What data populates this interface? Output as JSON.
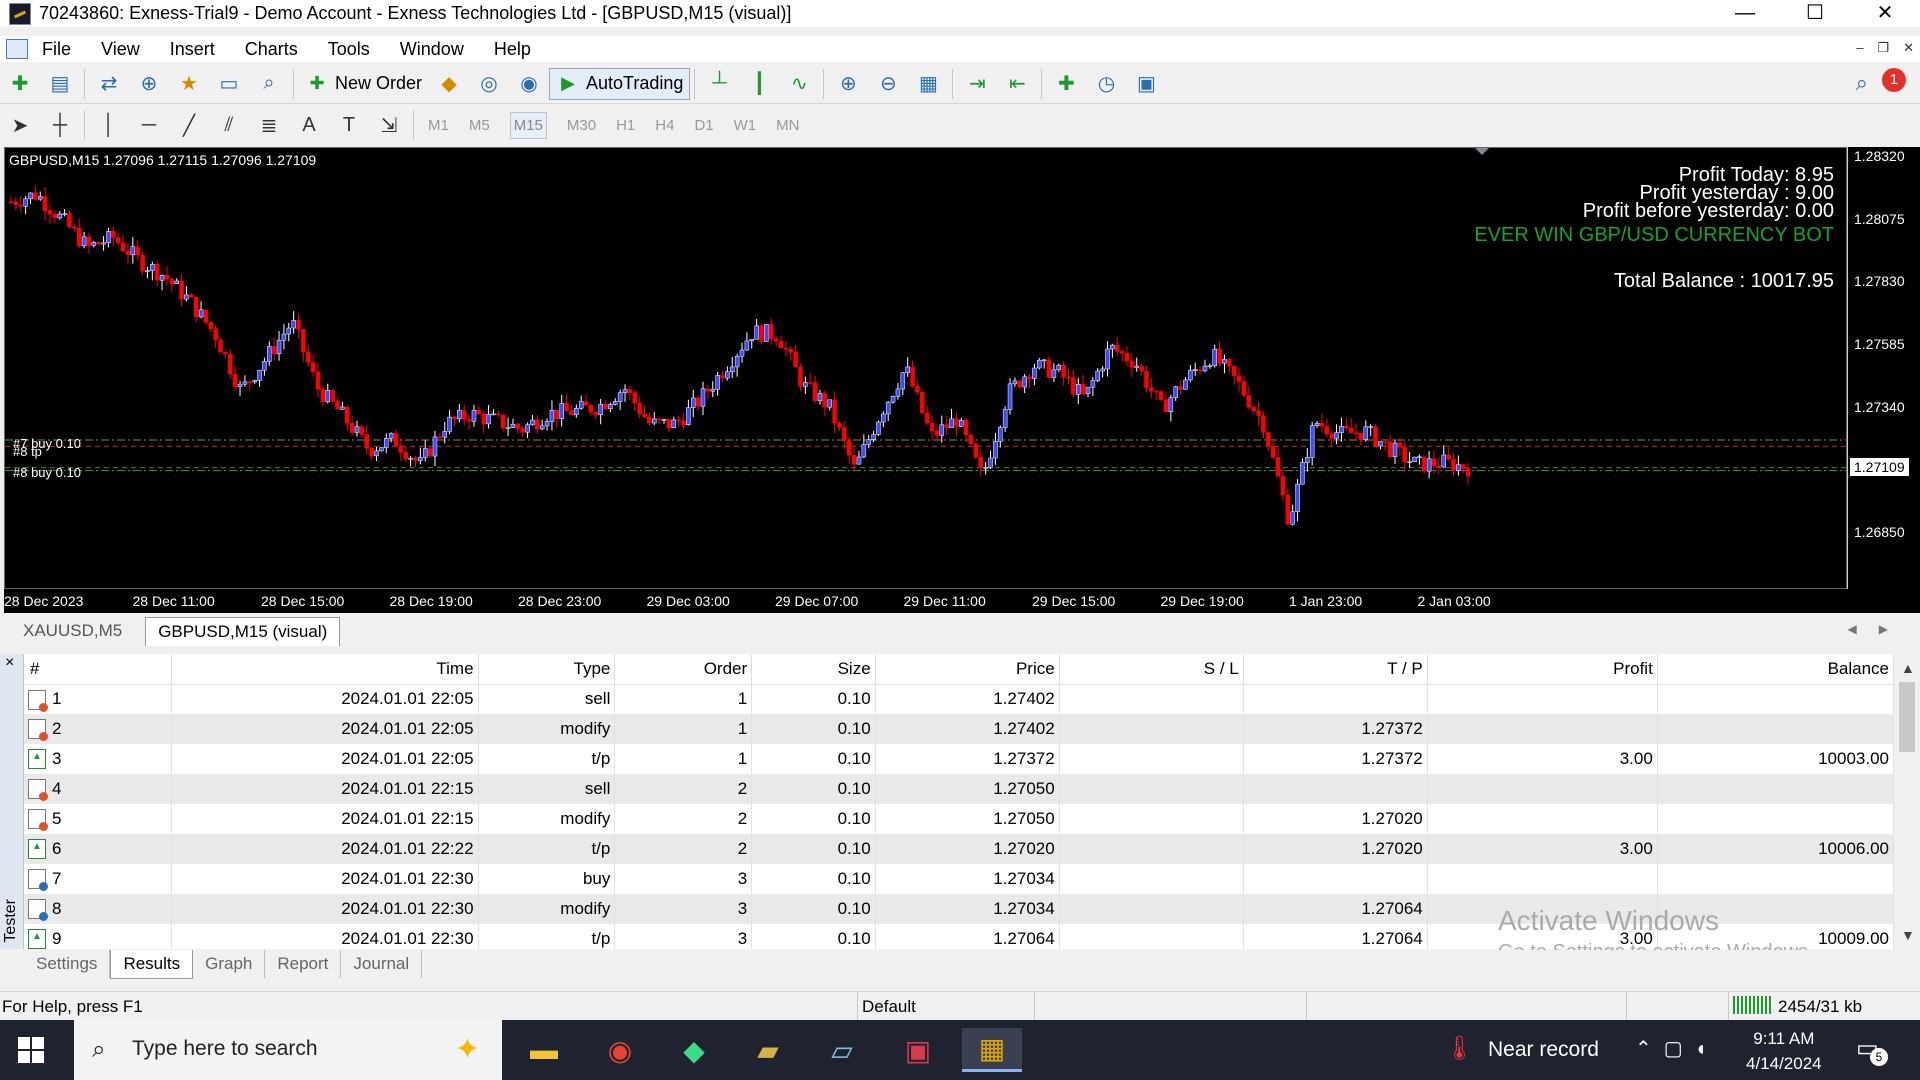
{
  "window": {
    "title": "70243860: Exness-Trial9 - Demo Account - Exness Technologies Ltd - [GBPUSD,M15 (visual)]",
    "minimize": "—",
    "maximize": "☐",
    "close": "✕"
  },
  "menu": [
    "File",
    "View",
    "Insert",
    "Charts",
    "Tools",
    "Window",
    "Help"
  ],
  "toolbar": {
    "new_order": "New Order",
    "autotrading": "AutoTrading",
    "alerts_count": "1"
  },
  "timeframes": [
    "M1",
    "M5",
    "M15",
    "M30",
    "H1",
    "H4",
    "D1",
    "W1",
    "MN"
  ],
  "timeframe_active": "M15",
  "chart": {
    "header": "GBPUSD,M15  1.27096 1.27115 1.27096 1.27109",
    "profit_today": "Profit Today: 8.95",
    "profit_yesterday": "Profit yesterday : 9.00",
    "profit_before_yesterday": "Profit before yesterday: 0.00",
    "bot_name": "EVER WIN GBP/USD CURRENCY BOT",
    "total_balance": "Total Balance : 10017.95",
    "order_label_1": "#7 buy 0.10",
    "order_label_2": "#8 tp",
    "order_label_3": "#8 buy 0.10",
    "current_price": "1.27109"
  },
  "chart_data": {
    "type": "candlestick",
    "symbol": "GBPUSD",
    "timeframe": "M15",
    "price_ticks": [
      "1.28320",
      "1.28075",
      "1.27830",
      "1.27585",
      "1.27340",
      "1.27109",
      "1.26850"
    ],
    "ylim": [
      1.2663,
      1.2836
    ],
    "time_ticks": [
      "28 Dec 2023",
      "28 Dec 11:00",
      "28 Dec 15:00",
      "28 Dec 19:00",
      "28 Dec 23:00",
      "29 Dec 03:00",
      "29 Dec 07:00",
      "29 Dec 11:00",
      "29 Dec 15:00",
      "29 Dec 19:00",
      "1 Jan 23:00",
      "2 Jan 03:00"
    ],
    "close_path": [
      1.2815,
      1.2818,
      1.2808,
      1.2797,
      1.2801,
      1.2792,
      1.2786,
      1.2776,
      1.2763,
      1.2741,
      1.2754,
      1.2768,
      1.2742,
      1.2731,
      1.2718,
      1.2722,
      1.2712,
      1.2728,
      1.2732,
      1.2729,
      1.2726,
      1.2732,
      1.2733,
      1.2735,
      1.2742,
      1.2728,
      1.2728,
      1.2738,
      1.2751,
      1.2764,
      1.2763,
      1.2743,
      1.2735,
      1.271,
      1.2732,
      1.275,
      1.2723,
      1.273,
      1.2707,
      1.274,
      1.2751,
      1.2748,
      1.2738,
      1.2758,
      1.2752,
      1.2734,
      1.2746,
      1.2755,
      1.2744,
      1.2728,
      1.269,
      1.2729,
      1.2724,
      1.2725,
      1.2718,
      1.2712,
      1.2713,
      1.2711
    ],
    "horizontal_levels": [
      {
        "price": 1.27217,
        "color": "#8a8a2a",
        "style": "dash-dot"
      },
      {
        "price": 1.27192,
        "color": "#cc2222",
        "style": "dash"
      },
      {
        "price": 1.27109,
        "color": "#2f8f2f",
        "style": "dash"
      },
      {
        "price": 1.27109,
        "color": "#3a9a3a",
        "style": "dash-dot"
      }
    ],
    "bull_color": "#ffffff",
    "bear_color": "#ff0000",
    "bull_body": "#3b4cff"
  },
  "chart_tabs": [
    "XAUUSD,M5",
    "GBPUSD,M15 (visual)"
  ],
  "tester": {
    "side_label": "Tester",
    "close": "×",
    "columns": [
      "#",
      "Time",
      "Type",
      "Order",
      "Size",
      "Price",
      "S / L",
      "T / P",
      "Profit",
      "Balance"
    ],
    "rows": [
      {
        "n": "1",
        "time": "2024.01.01 22:05",
        "type": "sell",
        "order": "1",
        "size": "0.10",
        "price": "1.27402",
        "sl": "",
        "tp": "",
        "profit": "",
        "balance": "",
        "icon": "sell"
      },
      {
        "n": "2",
        "time": "2024.01.01 22:05",
        "type": "modify",
        "order": "1",
        "size": "0.10",
        "price": "1.27402",
        "sl": "",
        "tp": "1.27372",
        "profit": "",
        "balance": "",
        "icon": "sell"
      },
      {
        "n": "3",
        "time": "2024.01.01 22:05",
        "type": "t/p",
        "order": "1",
        "size": "0.10",
        "price": "1.27372",
        "sl": "",
        "tp": "1.27372",
        "profit": "3.00",
        "balance": "10003.00",
        "icon": "tp"
      },
      {
        "n": "4",
        "time": "2024.01.01 22:15",
        "type": "sell",
        "order": "2",
        "size": "0.10",
        "price": "1.27050",
        "sl": "",
        "tp": "",
        "profit": "",
        "balance": "",
        "icon": "sell"
      },
      {
        "n": "5",
        "time": "2024.01.01 22:15",
        "type": "modify",
        "order": "2",
        "size": "0.10",
        "price": "1.27050",
        "sl": "",
        "tp": "1.27020",
        "profit": "",
        "balance": "",
        "icon": "sell"
      },
      {
        "n": "6",
        "time": "2024.01.01 22:22",
        "type": "t/p",
        "order": "2",
        "size": "0.10",
        "price": "1.27020",
        "sl": "",
        "tp": "1.27020",
        "profit": "3.00",
        "balance": "10006.00",
        "icon": "tp"
      },
      {
        "n": "7",
        "time": "2024.01.01 22:30",
        "type": "buy",
        "order": "3",
        "size": "0.10",
        "price": "1.27034",
        "sl": "",
        "tp": "",
        "profit": "",
        "balance": "",
        "icon": "buy"
      },
      {
        "n": "8",
        "time": "2024.01.01 22:30",
        "type": "modify",
        "order": "3",
        "size": "0.10",
        "price": "1.27034",
        "sl": "",
        "tp": "1.27064",
        "profit": "",
        "balance": "",
        "icon": "buy"
      },
      {
        "n": "9",
        "time": "2024.01.01 22:30",
        "type": "t/p",
        "order": "3",
        "size": "0.10",
        "price": "1.27064",
        "sl": "",
        "tp": "1.27064",
        "profit": "3.00",
        "balance": "10009.00",
        "icon": "tp"
      }
    ],
    "tabs": [
      "Settings",
      "Results",
      "Graph",
      "Report",
      "Journal"
    ],
    "active_tab": "Results"
  },
  "watermark": {
    "line1": "Activate Windows",
    "line2": "Go to Settings to activate Windows."
  },
  "status": {
    "help": "For Help, press F1",
    "profile": "Default",
    "traffic": "2454/31 kb"
  },
  "taskbar": {
    "search_placeholder": "Type here to search",
    "weather": "Near record",
    "time": "9:11 AM",
    "date": "4/14/2024",
    "notifications": "5"
  }
}
